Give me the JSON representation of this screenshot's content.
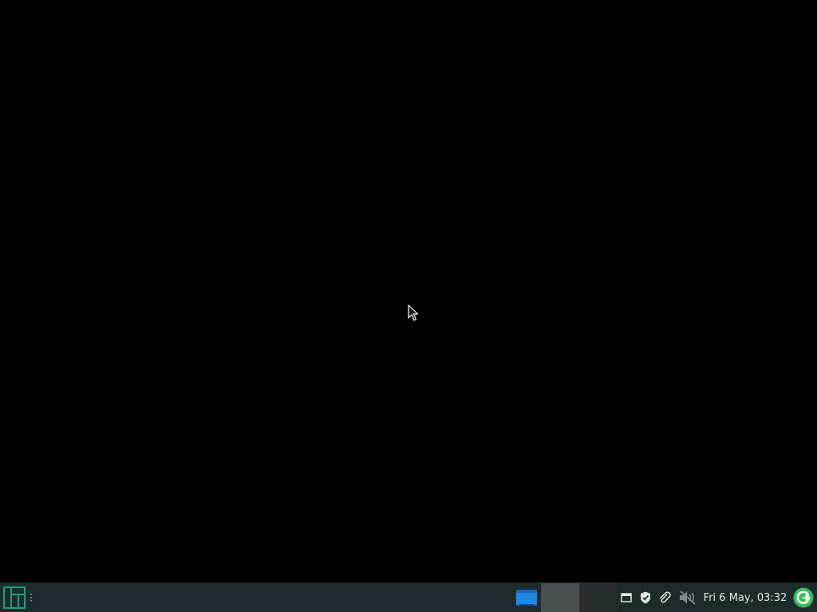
{
  "taskbar": {
    "clock": "Fri  6 May, 03:32",
    "workspaces": [
      {
        "active": true
      },
      {
        "active": false
      }
    ],
    "icons": {
      "menu": "manjaro-logo-icon",
      "handle": "panel-handle-icon",
      "show_desktop": "show-desktop-icon",
      "clipboard": "clipboard-icon",
      "shield": "shield-check-icon",
      "attach": "paperclip-icon",
      "volume": "volume-muted-icon",
      "update": "update-icon"
    }
  },
  "colors": {
    "desktop_background": "#000000",
    "taskbar_background": "#1f2a2c",
    "accent_green": "#35bf5c",
    "manjaro_teal": "#16a085",
    "window_blue": "#1e88e5"
  }
}
